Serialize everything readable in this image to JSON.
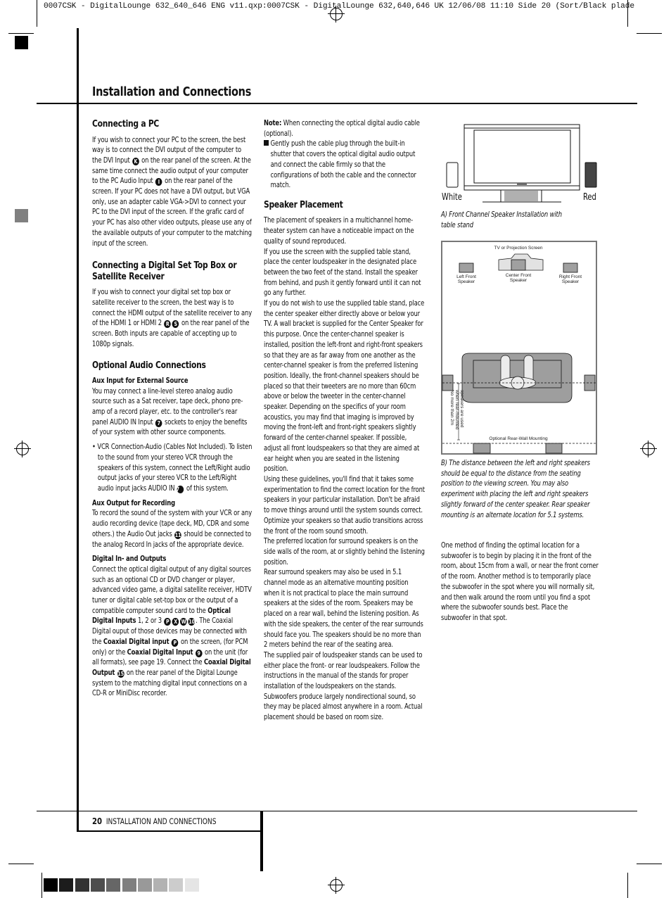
{
  "slug_line": "0007CSK - DigitalLounge 632_640_646 ENG v11.qxp:0007CSK - DigitalLounge 632,640,646 UK  12/06/08  11:10  Side 20    (Sort/Black plade",
  "page_title": "Installation and Connections",
  "col1": {
    "pc": {
      "heading": "Connecting a PC",
      "t1": "If you wish to connect your PC to the screen, the best way is to connect the DVI output of the computer to the DVI Input",
      "badge_k": "K",
      "t2": "on the rear panel of the screen. At the same time connect the audio output of your computer to the PC Audio Input",
      "badge_i": "I",
      "t3": "on the rear panel of the screen. If your PC does not have a DVI output, but VGA only, use an adapter cable VGA->DVI to connect your PC to the DVI input of the screen. If the grafic card of your PC has also other video outputs, please use any of the available outputs of your computer to the matching input of the screen."
    },
    "stb": {
      "heading": "Connecting a Digital Set Top Box or Satellite Receiver",
      "t1": "If you wish to connect your digital set top box or satellite receiver to the screen, the best way is to connect the HDMI output of the satellite receiver to any of the HDMI 1 or HDMI 2",
      "badge_r": "R",
      "badge_s": "S",
      "t2": "on the rear panel of the screen. Both inputs are capable of accepting up to 1080p signals."
    },
    "audio": {
      "heading": "Optional Audio Connections",
      "aux_in_heading": "Aux Input for External Source",
      "aux_in_t1": "You may connect a line-level stereo analog audio source such as a Sat receiver, tape deck, phono pre-amp of a record player, etc. to the controller's rear panel AUDIO IN Input",
      "badge_7": "7",
      "aux_in_t2": "sockets to enjoy the benefits of your system with other source components.",
      "vcr_t1": "• VCR Connection-Audio (Cables Not Included). To listen to the sound from your stereo VCR through the speakers of this system, connect the Left/Right audio output jacks of your stereo VCR to the Left/Right audio input jacks AUDIO IN",
      "vcr_t2": "of this system.",
      "aux_out_heading": "Aux Output for Recording",
      "aux_out_t1": "To record the sound of the system with your VCR or any audio recording device (tape deck, MD, CDR and some others.) the Audio Out jacks",
      "badge_11": "11",
      "aux_out_t2": "should be connected to the analog Record In jacks of the appropriate device.",
      "digital_heading": "Digital In- and Outputs",
      "dig_t1": "Connect the optical digital output of any digital sources such as an optional CD or DVD changer or player, advanced video game, a digital satellite receiver, HDTV tuner or digital cable set-top box or the output of a compatible computer sound card to the",
      "dig_b1": "Optical Digital Inputs",
      "dig_t2": "1, 2 or 3",
      "badges_opt": [
        "P",
        "X",
        "W",
        "10"
      ],
      "dig_t3": ". The Coaxial Digital ouput of those devices may be connected with the",
      "dig_b2": "Coaxial Digital input",
      "badge_p": "P",
      "dig_t4": "on the screen, (for PCM only) or the",
      "dig_b3": "Coaxial Digital Input",
      "badge_9": "9",
      "dig_t5": "on the unit (for all formats), see page 19. Connect the",
      "dig_b4": "Coaxial Digital Output",
      "badge_15": "15",
      "dig_t6": "on the rear panel of the Digital Lounge system to the matching digital input connections on a CD-R or MiniDisc recorder."
    }
  },
  "col2": {
    "note_label": "Note:",
    "note_text": "When connecting the optical digital audio cable (optional).",
    "note_bullet": "Gently push the cable plug through the built-in shutter that covers the optical digital audio output and connect the cable firmly so that the configurations of both the cable and the connector match.",
    "speaker_heading": "Speaker Placement",
    "paragraphs": [
      "The placement of speakers in a multichannel home-theater system can have a noticeable impact on the quality of sound reproduced.",
      "If you use the screen with the supplied table stand, place the center loudspeaker in the designated place between the two feet of the stand. Install the speaker from behind, and push it gently forward until it can not go any further.",
      "If you do not wish to use the supplied table stand, place the center speaker either directly above or below your TV. A wall bracket is supplied for the Center Speaker for this purpose. Once the center-channel speaker is installed, position the left-front and right-front speakers so that they are as far away from one another as the center-channel speaker is from the preferred listening position. Ideally, the front-channel speakers should be placed so that their tweeters are no more than 60cm above or below the tweeter in the center-channel speaker. Depending on the specifics of your room acoustics, you may find that imaging is improved by moving the front-left and front-right speakers slightly forward of the center-channel speaker. If possible, adjust all front loudspeakers so that they are aimed at ear height when you are seated in the listening position.",
      "Using these guidelines, you'll find that it takes some experimentation to find the correct location for the front speakers in your particular installation. Don't be afraid to move things around until the system sounds correct. Optimize your speakers so that audio transitions across the front of the room sound smooth.",
      "The preferred location for surround speakers is on the side walls of the room, at or slightly behind the listening position.",
      "Rear surround speakers may also be used in 5.1 channel mode as an alternative mounting position when it is not practical to place the main surround speakers at the sides of the room. Speakers may be placed on a rear wall, behind the listening position. As with the side speakers, the center of the rear surrounds should face you. The speakers should be no more than 2 meters behind the rear of the seating area.",
      "The supplied pair of loudspeaker stands can be used to either place the front- or rear loudspeakers. Follow the instructions in the manual of the stands for proper installation of the loudspeakers on the stands.",
      "Subwoofers produce largely nondirectional sound, so they may be placed almost anywhere in a room. Actual placement should be based on room size."
    ]
  },
  "col3": {
    "fig_a": {
      "label_white": "White",
      "label_red": "Red",
      "caption": "A)  Front Channel Speaker Installation with table stand"
    },
    "fig_b": {
      "screen_label": "TV or Projection Screen",
      "left_front": [
        "Left Front",
        "Speaker"
      ],
      "center_front": [
        "Center Front",
        "Speaker"
      ],
      "right_front": [
        "Right Front",
        "Speaker"
      ],
      "vertical_note": [
        "No more than 2m",
        "when rear-mounted",
        "speakers are used"
      ],
      "rear_label": "Optional Rear-Wall Mounting",
      "caption": "B)  The distance between the left and right speakers should be equal to the distance from the seating position to the viewing screen. You may also experiment with placing the left and right speakers slightly forward of the center speaker. Rear speaker mounting is an alternate location for 5.1 systems."
    },
    "subwoofer_text": "One method of finding the optimal location for a subwoofer is to begin by placing it in the front of the room, about 15cm from a wall, or near the front corner of the room. Another method is to temporarily place the subwoofer in the spot where you will normally sit, and then walk around the room until you find a spot where the subwoofer sounds best. Place the subwoofer in that spot."
  },
  "footer": {
    "page_number": "20",
    "section": "INSTALLATION AND CONNECTIONS"
  },
  "colors": {
    "grayscale_swatches": [
      "#000000",
      "#1c1c1c",
      "#333333",
      "#4d4d4d",
      "#666666",
      "#7f7f7f",
      "#999999",
      "#b2b2b2",
      "#cccccc",
      "#e5e5e5"
    ],
    "speaker_fill": "#a0a0a0",
    "sofa_fill": "#9e9e9e"
  }
}
